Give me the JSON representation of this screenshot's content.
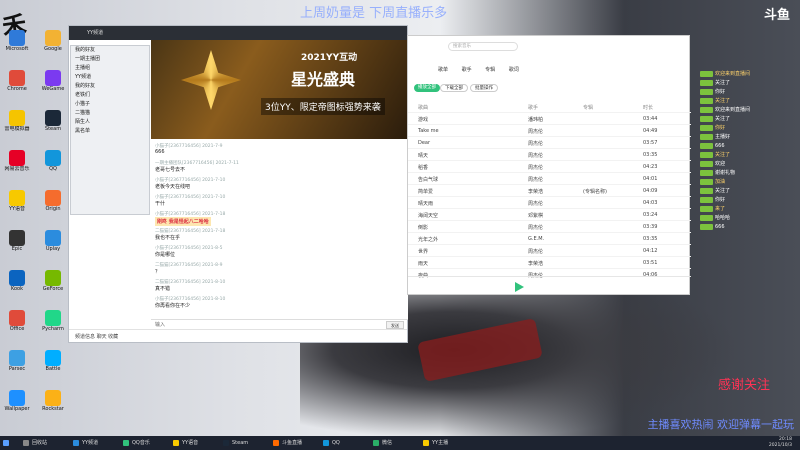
{
  "overlay_top": "上周奶量是 下周直播乐多",
  "brand": "斗鱼",
  "logo": "禾",
  "follow": "感谢关注",
  "caption": "主播喜欢热闹 欢迎弹幕一起玩",
  "desktop_icons": [
    {
      "label": "Microsoft",
      "color": "#2f7ad9"
    },
    {
      "label": "Google",
      "color": "#f2b233"
    },
    {
      "label": "Chrome",
      "color": "#e04b3a"
    },
    {
      "label": "WeGame",
      "color": "#7b3af0"
    },
    {
      "label": "雷电模拟器",
      "color": "#f5c400"
    },
    {
      "label": "Steam",
      "color": "#1b2838"
    },
    {
      "label": "网易云音乐",
      "color": "#e60026"
    },
    {
      "label": "QQ",
      "color": "#1296db"
    },
    {
      "label": "YY语音",
      "color": "#f7c900"
    },
    {
      "label": "Origin",
      "color": "#f56c2d"
    },
    {
      "label": "Epic",
      "color": "#333"
    },
    {
      "label": "Uplay",
      "color": "#2b8cde"
    },
    {
      "label": "Kook",
      "color": "#0b64c0"
    },
    {
      "label": "GeForce",
      "color": "#76b900"
    },
    {
      "label": "Office",
      "color": "#e04b3a"
    },
    {
      "label": "Pycharm",
      "color": "#21d789"
    },
    {
      "label": "Parsec",
      "color": "#3da0e3"
    },
    {
      "label": "Battle",
      "color": "#00aeff"
    },
    {
      "label": "Wallpaper",
      "color": "#1e90ff"
    },
    {
      "label": "Rockstar",
      "color": "#fbb117"
    }
  ],
  "yy": {
    "title": "YY频道",
    "banner_small": "2021YY互动",
    "banner_big": "星光盛典",
    "banner_sub": "3位YY、限定帝图标强势来袭",
    "messages": [
      {
        "h": "小猫子[2367716456] 2021-7-9",
        "b": "666"
      },
      {
        "h": "一期主播团队[2367716456] 2021-7-11",
        "b": "老哥七号去不"
      },
      {
        "h": "小猫子[2367716456] 2021-7-10",
        "b": "老板今天在线吧"
      },
      {
        "h": "小猫子[2367716456] 2021-7-10",
        "b": "干什"
      },
      {
        "h": "小猫子[2367716456] 2021-7-18",
        "b": "刚咚 我是怪起八二哈哈",
        "gift": true
      },
      {
        "h": "二猫猫[2367716456] 2021-7-18",
        "b": "我也不在乎"
      },
      {
        "h": "小猫子[2367716456] 2021-8-5",
        "b": "你是哪位"
      },
      {
        "h": "二猫猫[2367716456] 2021-8-9",
        "b": "？"
      },
      {
        "h": "二猫猫[2367716456] 2021-8-10",
        "b": "真不错"
      },
      {
        "h": "小猫子[2367716456] 2021-8-10",
        "b": "你再看你在不少"
      }
    ],
    "input_placeholder": "输入",
    "send": "发送",
    "bottom": "频道信息  聊天  收藏"
  },
  "list": [
    "我的好友",
    "一期主播团",
    "主播组",
    "YY频道",
    "我的好友",
    "老铁们",
    "小猫子",
    "二猫猫",
    "陌生人",
    "黑名单"
  ],
  "music": {
    "search_placeholder": "搜索音乐",
    "tabs": "歌单 歌手 专辑 歌词",
    "play_all": "播放全部",
    "download": "下载全部",
    "collect": "批量操作",
    "head": [
      "歌曲",
      "歌手",
      "专辑",
      "时长"
    ],
    "rows": [
      [
        "游戏",
        "潘玮柏",
        "",
        "03:44"
      ],
      [
        "Take me",
        "周杰伦",
        "",
        "04:49"
      ],
      [
        "Dear",
        "周杰伦",
        "",
        "03:57"
      ],
      [
        "晴天",
        "周杰伦",
        "",
        "03:35"
      ],
      [
        "稻香",
        "周杰伦",
        "",
        "04:23"
      ],
      [
        "告白气球",
        "周杰伦",
        "",
        "04:01"
      ],
      [
        "简单爱",
        "李荣浩",
        "(专辑名称)",
        "04:09"
      ],
      [
        "晴天雨",
        "周杰伦",
        "",
        "04:03"
      ],
      [
        "海阔天空",
        "邓紫棋",
        "",
        "03:24"
      ],
      [
        "倒影",
        "周杰伦",
        "",
        "03:39"
      ],
      [
        "光年之外",
        "G.E.M.",
        "",
        "03:35"
      ],
      [
        "世界",
        "周杰伦",
        "",
        "04:12"
      ],
      [
        "雨天",
        "李荣浩",
        "",
        "03:51"
      ],
      [
        "夜曲",
        "周杰伦",
        "",
        "04:06"
      ]
    ]
  },
  "danmaku": [
    "欢迎来到直播间",
    "关注了",
    "你好",
    "关注了",
    "欢迎来到直播间",
    "关注了",
    "你好",
    "主播好",
    "666",
    "关注了",
    "欢迎",
    "谢谢礼物",
    "加油",
    "关注了",
    "你好",
    "来了",
    "哈哈哈",
    "666"
  ],
  "taskbar": {
    "items": [
      {
        "label": "回收站",
        "color": "#888"
      },
      {
        "label": "YY频道",
        "color": "#2b8cde"
      },
      {
        "label": "QQ音乐",
        "color": "#31c27c"
      },
      {
        "label": "YY语音",
        "color": "#f7c900"
      },
      {
        "label": "Steam",
        "color": "#1b2838"
      },
      {
        "label": "斗鱼直播",
        "color": "#ff6a00"
      },
      {
        "label": "QQ",
        "color": "#1296db"
      },
      {
        "label": "微信",
        "color": "#2aae67"
      },
      {
        "label": "YY主播",
        "color": "#f7c900"
      }
    ],
    "time": "20:18",
    "date": "2021/10/3"
  }
}
